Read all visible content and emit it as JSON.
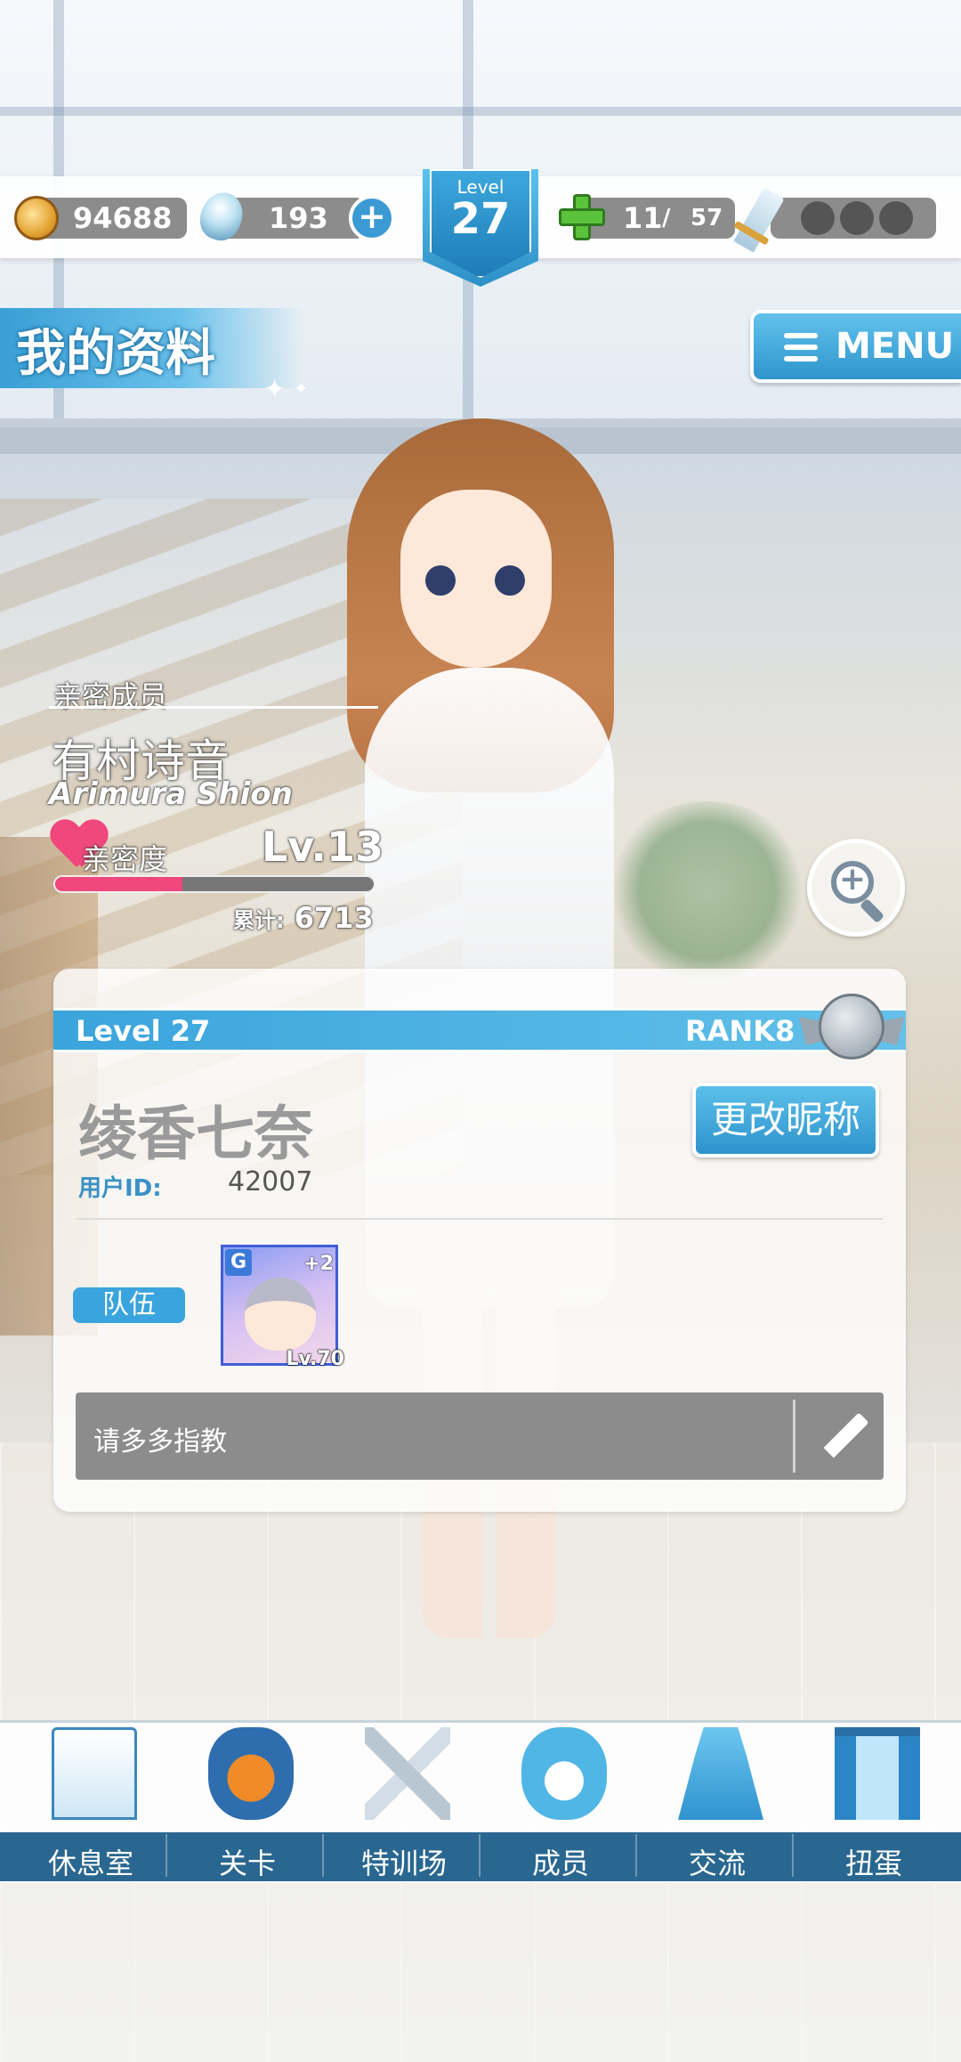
{
  "hud": {
    "coins": "94688",
    "gems": "193",
    "level_label": "Level",
    "level": "27",
    "stamina_current": "11",
    "stamina_sep": " / ",
    "stamina_max": "57"
  },
  "header": {
    "title": "我的资料",
    "menu_label": "MENU"
  },
  "intimacy_member": {
    "section_label": "亲密成员",
    "name": "有村诗音",
    "romanized": "Arimura Shion",
    "affection_label": "亲密度",
    "level": "Lv.13",
    "progress": 0.4,
    "total_label": "累计:",
    "total": "6713"
  },
  "profile": {
    "level": "Level 27",
    "rank": "RANK8",
    "nickname": "绫香七奈",
    "change_nickname_label": "更改昵称",
    "user_id_label": "用户ID:",
    "user_id": "42007",
    "team_label": "队伍",
    "team_card": {
      "rarity": "G",
      "bonus": "+2",
      "level": "Lv.70"
    },
    "comment": "请多多指教"
  },
  "bottom_nav": [
    {
      "label": "休息室",
      "icon": "lounge-building-icon"
    },
    {
      "label": "关卡",
      "icon": "stage-demon-icon"
    },
    {
      "label": "特训场",
      "icon": "training-swords-icon"
    },
    {
      "label": "成员",
      "icon": "member-cat-icon"
    },
    {
      "label": "交流",
      "icon": "communication-dress-icon"
    },
    {
      "label": "扭蛋",
      "icon": "gacha-curtain-icon"
    }
  ],
  "colors": {
    "accent_blue": "#3aa4dc",
    "affection_pink": "#f0477c",
    "nav_strip": "#2a6790",
    "stamina_green": "#5bc23b"
  }
}
